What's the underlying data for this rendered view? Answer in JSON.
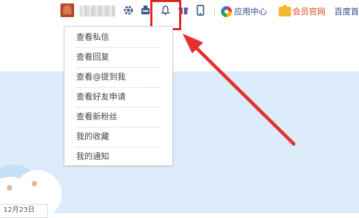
{
  "toolbar": {
    "icons": [
      "avatar",
      "settings-gear-icon",
      "mailbox-icon",
      "bell-icon",
      "gift-icon",
      "mobile-icon"
    ],
    "app_center_label": "应用中心",
    "vip_label": "会员官网",
    "baidu_home_label": "百度首"
  },
  "dropdown": {
    "items": [
      {
        "label": "查看私信"
      },
      {
        "label": "查看回复"
      },
      {
        "label": "查看@提到我"
      },
      {
        "label": "查看好友申请"
      },
      {
        "label": "查看新粉丝"
      },
      {
        "label": "我的收藏"
      },
      {
        "label": "我的通知"
      }
    ]
  },
  "background": {
    "date_partial": "12月23日"
  },
  "colors": {
    "highlight": "#e02020",
    "sky": "#dcecfa",
    "link": "#2a4a8a",
    "vip": "#e0451f"
  }
}
